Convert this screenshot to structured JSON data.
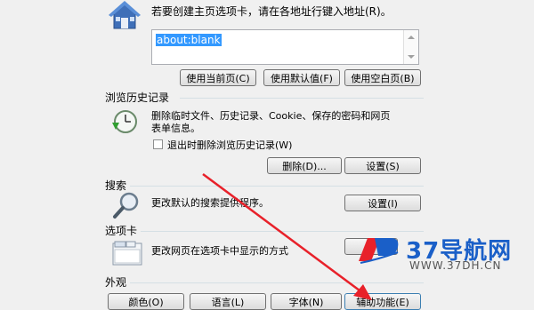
{
  "home": {
    "description": "若要创建主页选项卡，请在各地址行键入地址(R)。",
    "address_value": "about:blank",
    "buttons": [
      "使用当前页(C)",
      "使用默认值(F)",
      "使用空白页(B)"
    ]
  },
  "history": {
    "title": "浏览历史记录",
    "description_line1": "删除临时文件、历史记录、Cookie、保存的密码和网页",
    "description_line2": "表单信息。",
    "checkbox_label": "退出时删除浏览历史记录(W)",
    "delete_button": "删除(D)...",
    "settings_button": "设置(S)"
  },
  "search": {
    "title": "搜索",
    "description": "更改默认的搜索提供程序。",
    "settings_button": "设置(I)"
  },
  "tabs": {
    "title": "选项卡",
    "description": "更改网页在选项卡中显示的方式"
  },
  "appearance": {
    "title": "外观",
    "buttons": [
      "颜色(O)",
      "语言(L)",
      "字体(N)",
      "辅助功能(E)"
    ]
  },
  "watermark": {
    "brand": "37导航网",
    "url": "WWW.37DH.CN"
  },
  "colors": {
    "arrow": "#e8212a",
    "selection": "#3399ff",
    "watermark_blue": "#1a5fc8"
  }
}
